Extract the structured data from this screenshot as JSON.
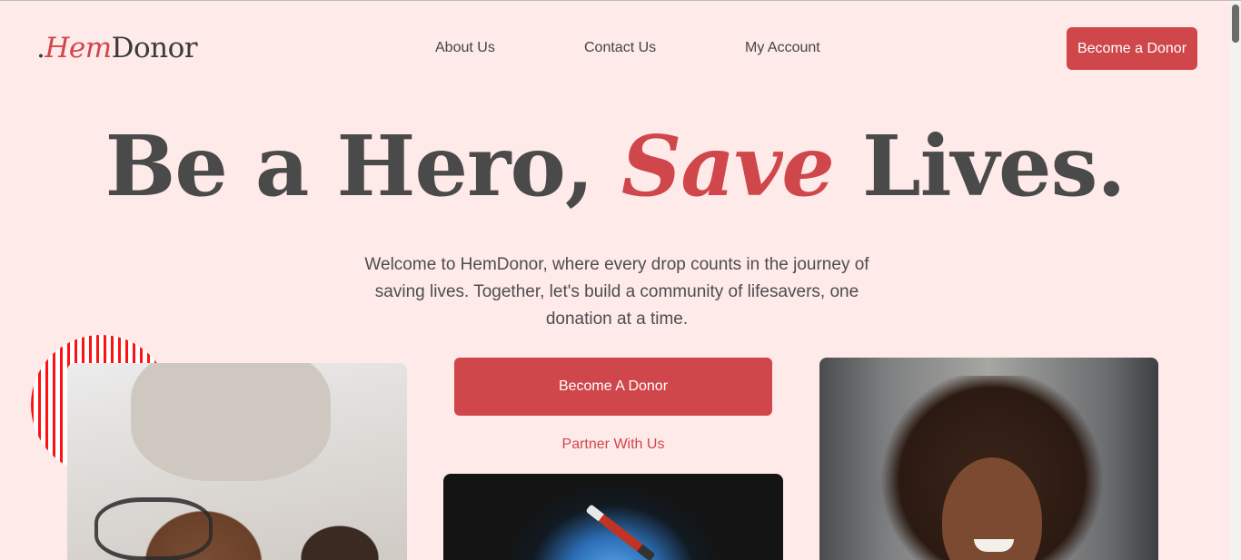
{
  "brand": {
    "dot": ".",
    "hem": "Hem",
    "donor": "Donor"
  },
  "nav": {
    "about": "About Us",
    "contact": "Contact Us",
    "account": "My Account",
    "cta": "Become a Donor"
  },
  "hero": {
    "title_part1": "Be a Hero, ",
    "title_accent": "Save",
    "title_part2": " Lives.",
    "description": "Welcome to HemDonor, where every drop counts in the journey of saving lives. Together, let's build a community of lifesavers, one donation at a time.",
    "primary_button": "Become A Donor",
    "secondary_link": "Partner With Us"
  },
  "colors": {
    "background": "#ffeaea",
    "accent": "#cf474b",
    "heading": "#4a4a4a"
  }
}
